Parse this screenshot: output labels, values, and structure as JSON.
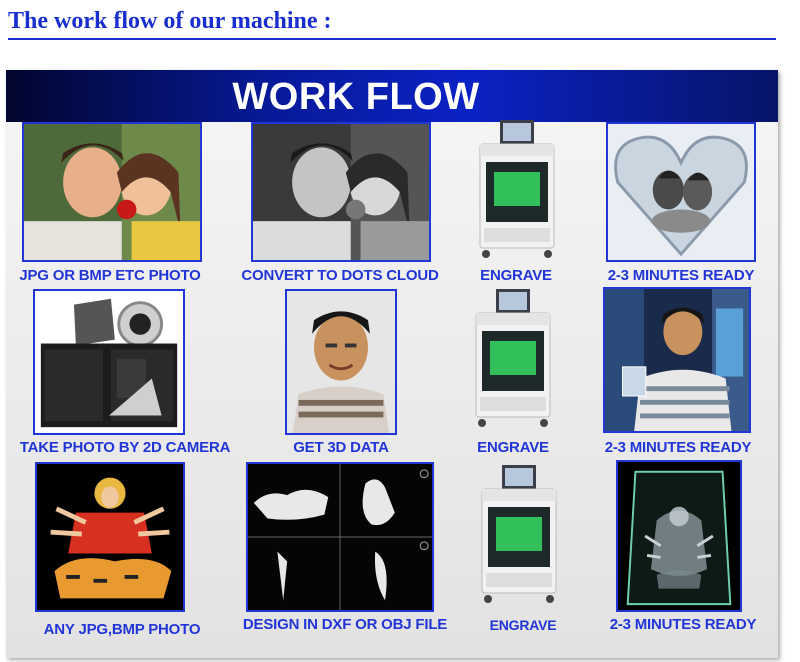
{
  "heading": "The work flow of our machine :",
  "banner_title": "WORK FLOW",
  "rows": [
    {
      "steps": [
        {
          "caption": "JPG OR BMP ETC PHOTO",
          "icon": "couple-photo-icon"
        },
        {
          "caption": "CONVERT TO DOTS CLOUD",
          "icon": "grayscale-photo-icon"
        },
        {
          "caption": "ENGRAVE",
          "icon": "engraving-machine-icon"
        },
        {
          "caption": "2-3 MINUTES READY",
          "icon": "heart-crystal-icon"
        }
      ]
    },
    {
      "steps": [
        {
          "caption": "TAKE PHOTO BY 2D CAMERA",
          "icon": "camera-icon"
        },
        {
          "caption": "GET 3D DATA",
          "icon": "portrait-icon"
        },
        {
          "caption": "ENGRAVE",
          "icon": "engraving-machine-icon"
        },
        {
          "caption": "2-3 MINUTES READY",
          "icon": "man-holding-crystal-icon"
        }
      ]
    },
    {
      "steps": [
        {
          "caption": "ANY JPG,BMP PHOTO",
          "icon": "goddess-picture-icon"
        },
        {
          "caption": "DESIGN IN DXF OR OBJ FILE",
          "icon": "cad-design-icon"
        },
        {
          "caption": "ENGRAVE",
          "icon": "engraving-machine-icon"
        },
        {
          "caption": "2-3 MINUTES READY",
          "icon": "crystal-block-icon"
        }
      ]
    }
  ]
}
